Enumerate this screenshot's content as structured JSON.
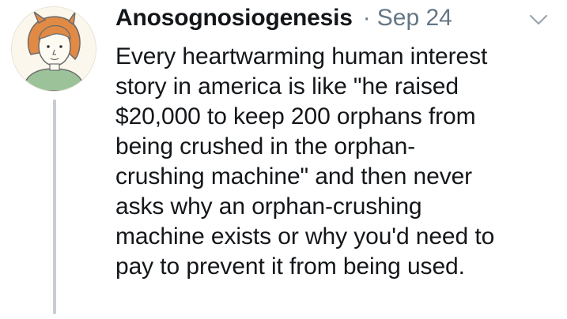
{
  "tweet": {
    "author_name": "Anosognosiogenesis",
    "separator": "·",
    "date": "Sep 24",
    "text": "Every heartwarming human interest\nstory in america is like \"he raised\n$20,000 to keep 200 orphans from\nbeing crushed in the orphan-\ncrushing machine\" and then never\nasks why an orphan-crushing\nmachine exists or why you'd need to\npay to prevent it from being used."
  },
  "icons": {
    "avatar": "cartoon-avatar",
    "menu": "chevron-down-icon"
  },
  "colors": {
    "text": "#14171a",
    "secondary": "#657786",
    "thread_line": "#c7cdd3",
    "avatar_hair": "#e08a45",
    "avatar_shirt": "#9cc29a"
  }
}
